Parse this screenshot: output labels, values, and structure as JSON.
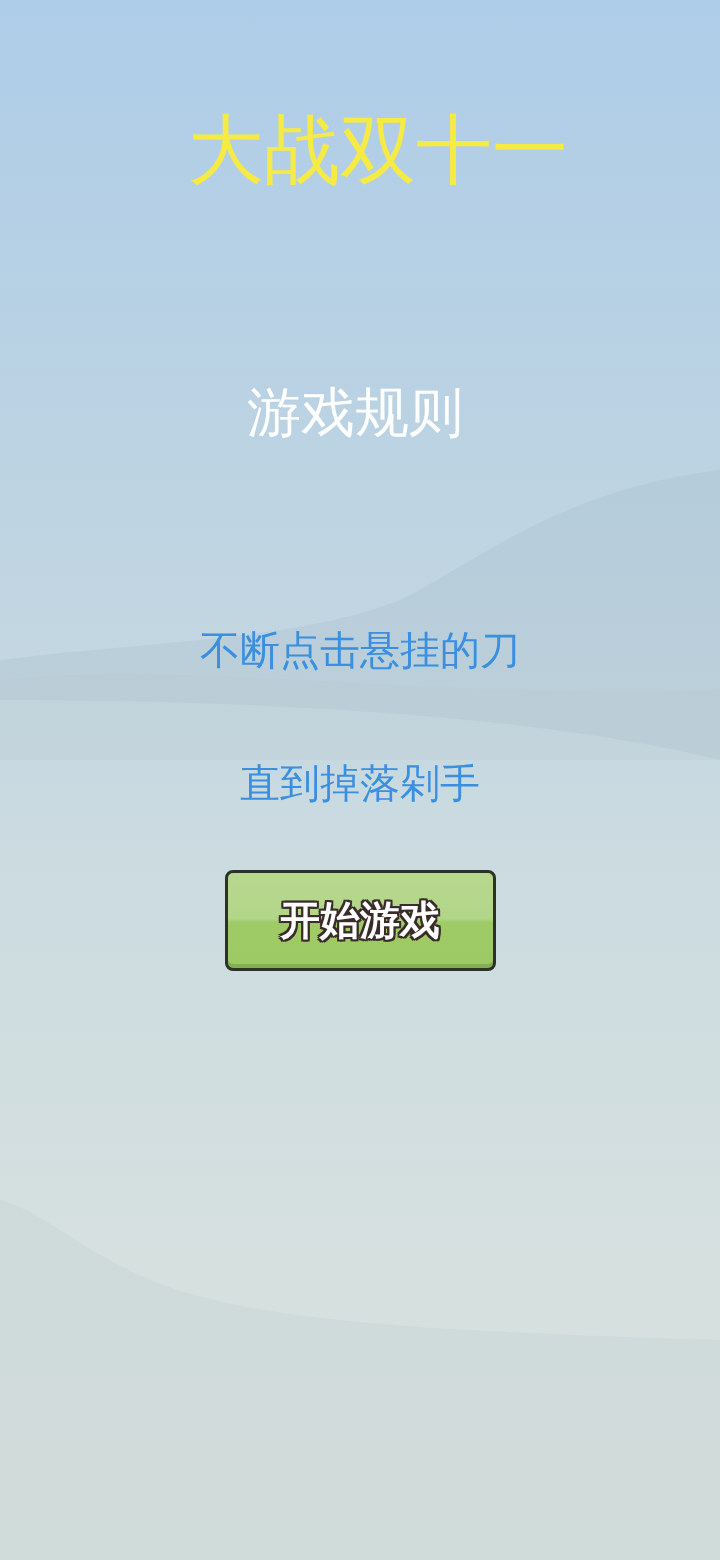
{
  "title": "大战双十一",
  "rules": {
    "heading": "游戏规则",
    "lines": [
      "不断点击悬挂的刀",
      "直到掉落剁手"
    ]
  },
  "start_button": {
    "label": "开始游戏"
  }
}
